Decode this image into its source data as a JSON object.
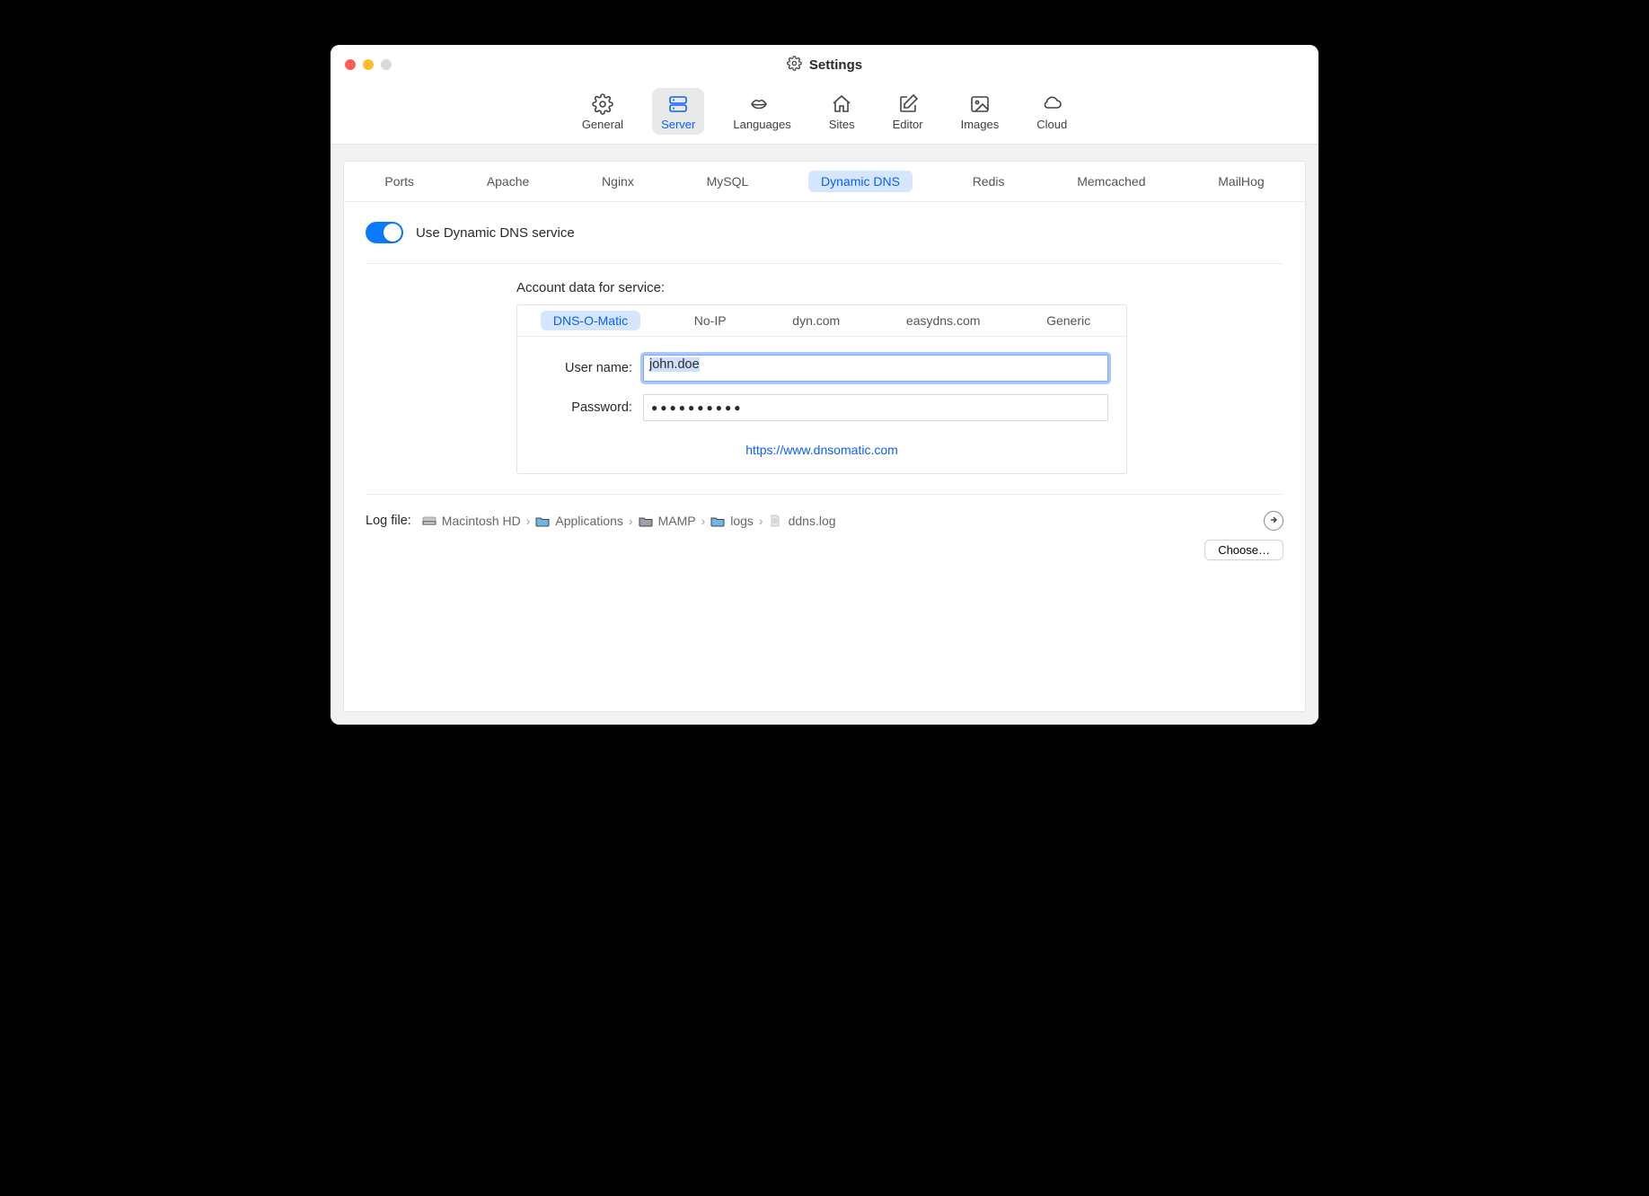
{
  "window": {
    "title": "Settings"
  },
  "toolbar": {
    "items": [
      {
        "label": "General"
      },
      {
        "label": "Server"
      },
      {
        "label": "Languages"
      },
      {
        "label": "Sites"
      },
      {
        "label": "Editor"
      },
      {
        "label": "Images"
      },
      {
        "label": "Cloud"
      }
    ],
    "active_index": 1
  },
  "server_tabs": {
    "items": [
      "Ports",
      "Apache",
      "Nginx",
      "MySQL",
      "Dynamic DNS",
      "Redis",
      "Memcached",
      "MailHog"
    ],
    "active_index": 4
  },
  "ddns": {
    "toggle_label": "Use Dynamic DNS service",
    "toggle_on": true,
    "account_heading": "Account data for service:",
    "providers": [
      "DNS-O-Matic",
      "No-IP",
      "dyn.com",
      "easydns.com",
      "Generic"
    ],
    "provider_active_index": 0,
    "username_label": "User name:",
    "username_value": "john.doe",
    "password_label": "Password:",
    "password_mask": "●●●●●●●●●●",
    "provider_url": "https://www.dnsomatic.com"
  },
  "logfile": {
    "label": "Log file:",
    "segments": [
      "Macintosh HD",
      "Applications",
      "MAMP",
      "logs",
      "ddns.log"
    ],
    "choose_label": "Choose…"
  }
}
